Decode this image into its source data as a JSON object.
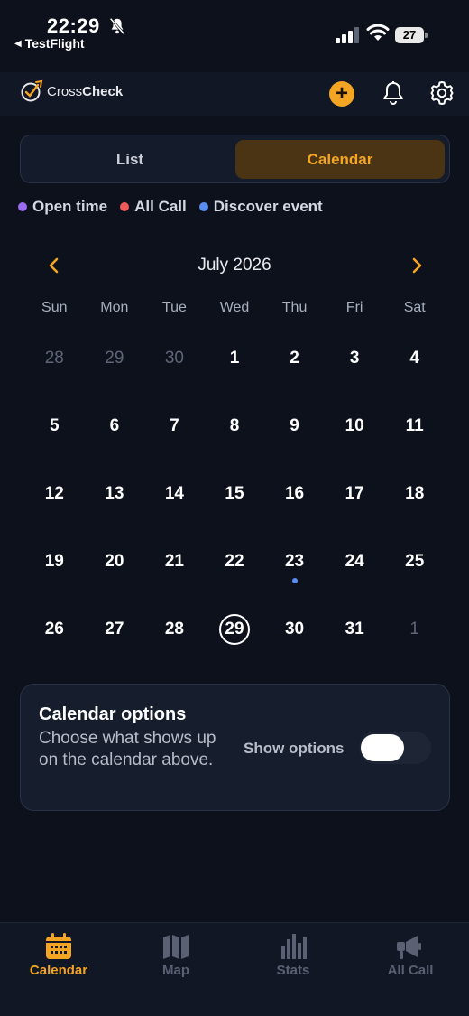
{
  "status_bar": {
    "time": "22:29",
    "back_app": "TestFlight",
    "battery": "27"
  },
  "header": {
    "logo_plain": "Cross",
    "logo_bold": "Check",
    "add_label": "+"
  },
  "segmented": {
    "list_label": "List",
    "calendar_label": "Calendar",
    "selected": "Calendar"
  },
  "legend": [
    {
      "label": "Open time",
      "color": "#9b6cf0"
    },
    {
      "label": "All Call",
      "color": "#ef5b5b"
    },
    {
      "label": "Discover event",
      "color": "#5b8def"
    }
  ],
  "calendar": {
    "month_title": "July 2026",
    "weekdays": [
      "Sun",
      "Mon",
      "Tue",
      "Wed",
      "Thu",
      "Fri",
      "Sat"
    ],
    "days": [
      {
        "n": "28",
        "muted": true
      },
      {
        "n": "29",
        "muted": true
      },
      {
        "n": "30",
        "muted": true
      },
      {
        "n": "1"
      },
      {
        "n": "2"
      },
      {
        "n": "3"
      },
      {
        "n": "4"
      },
      {
        "n": "5"
      },
      {
        "n": "6"
      },
      {
        "n": "7"
      },
      {
        "n": "8"
      },
      {
        "n": "9"
      },
      {
        "n": "10"
      },
      {
        "n": "11"
      },
      {
        "n": "12"
      },
      {
        "n": "13"
      },
      {
        "n": "14"
      },
      {
        "n": "15"
      },
      {
        "n": "16"
      },
      {
        "n": "17"
      },
      {
        "n": "18"
      },
      {
        "n": "19"
      },
      {
        "n": "20"
      },
      {
        "n": "21"
      },
      {
        "n": "22"
      },
      {
        "n": "23",
        "event": "Discover event"
      },
      {
        "n": "24"
      },
      {
        "n": "25"
      },
      {
        "n": "26"
      },
      {
        "n": "27"
      },
      {
        "n": "28"
      },
      {
        "n": "29",
        "today": true
      },
      {
        "n": "30"
      },
      {
        "n": "31"
      },
      {
        "n": "1",
        "muted": true
      }
    ]
  },
  "options": {
    "title": "Calendar options",
    "description": "Choose what shows up on the calendar above.",
    "toggle_label": "Show options",
    "toggle_on": false
  },
  "tabs": [
    {
      "label": "Calendar",
      "icon": "calendar-icon",
      "active": true
    },
    {
      "label": "Map",
      "icon": "map-icon",
      "active": false
    },
    {
      "label": "Stats",
      "icon": "stats-icon",
      "active": false
    },
    {
      "label": "All Call",
      "icon": "megaphone-icon",
      "active": false
    }
  ],
  "colors": {
    "accent": "#f5a524",
    "background": "#0d111c"
  }
}
